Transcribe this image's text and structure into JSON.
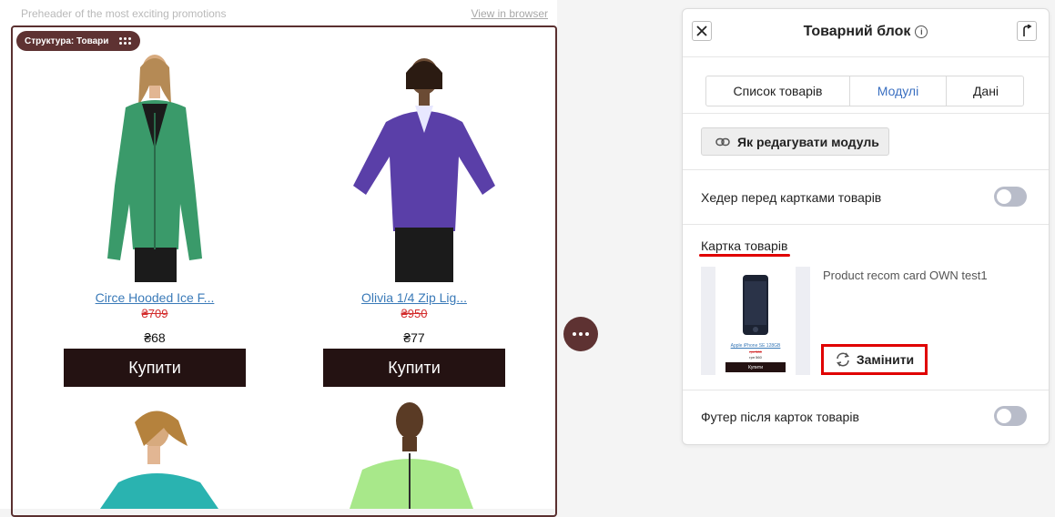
{
  "email": {
    "preheader": "Preheader of the most exciting promotions",
    "view_in_browser": "View in browser",
    "structure_badge": "Структура: Товари",
    "products": [
      {
        "title": "Circe Hooded Ice F...",
        "old_price": "₴709",
        "price": "₴68",
        "buy": "Купити",
        "color": "#3a9a6a"
      },
      {
        "title": "Olivia 1/4 Zip Lig...",
        "old_price": "₴950",
        "price": "₴77",
        "buy": "Купити",
        "color": "#5a3fa8"
      }
    ]
  },
  "panel": {
    "title": "Товарний блок",
    "tabs": [
      {
        "label": "Список товарів",
        "active": false
      },
      {
        "label": "Модулі",
        "active": true
      },
      {
        "label": "Дані",
        "active": false
      }
    ],
    "how_to_edit": "Як редагувати модуль",
    "header_toggle_label": "Хедер перед картками товарів",
    "card_section_label": "Картка товарів",
    "card_name": "Product recom card OWN test1",
    "thumb": {
      "link": "Apple iPhone SE 128GB",
      "old": "грн 580",
      "new": "грн 560",
      "buy": "Купити"
    },
    "replace": "Замінити",
    "footer_toggle_label": "Футер після карток товарів"
  },
  "colors": {
    "brand": "#5e3232",
    "highlight": "#e00000",
    "link": "#3a7ab8",
    "active_tab": "#3a6fc1"
  }
}
